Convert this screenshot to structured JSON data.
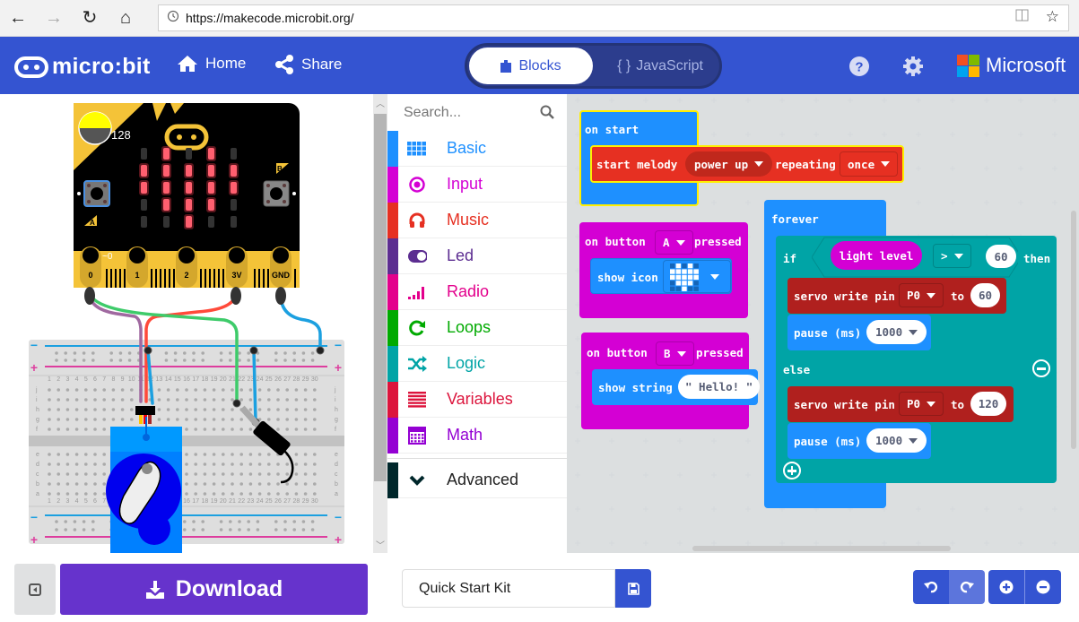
{
  "browser": {
    "url": "https://makecode.microbit.org/",
    "back_icon": "arrow-left",
    "forward_icon": "arrow-right",
    "refresh_icon": "refresh",
    "home_icon": "home",
    "back_glyph": "←",
    "forward_glyph": "→",
    "refresh_glyph": "↻",
    "home_glyph": "⌂",
    "star_glyph": "☆",
    "reader_glyph": "▯"
  },
  "header": {
    "logo_text": "micro:bit",
    "home_label": "Home",
    "share_label": "Share",
    "mode_blocks_label": "Blocks",
    "mode_js_label": "JavaScript",
    "mode_js_prefix": "{ }",
    "active_mode": "Blocks",
    "brand_label": "Microsoft",
    "colors": {
      "header_bg": "#3454d1",
      "toggle_bg": "#2c3d8d"
    }
  },
  "simulator": {
    "light_level_value": "128",
    "pin0_value": "~0",
    "pins": [
      "0",
      "1",
      "2",
      "3V",
      "GND"
    ],
    "button_a": "A",
    "button_b": "B",
    "led_matrix": [
      [
        0,
        1,
        0,
        1,
        0
      ],
      [
        1,
        1,
        1,
        1,
        1
      ],
      [
        1,
        1,
        1,
        1,
        1
      ],
      [
        0,
        1,
        1,
        1,
        0
      ],
      [
        0,
        0,
        1,
        0,
        0
      ]
    ],
    "breadboard_cols": [
      "1",
      "2",
      "3",
      "4",
      "5",
      "6",
      "7",
      "8",
      "9",
      "10",
      "11",
      "12",
      "13",
      "14",
      "15",
      "16",
      "17",
      "18",
      "19",
      "20",
      "21",
      "22",
      "23",
      "24",
      "25",
      "26",
      "27",
      "28",
      "29",
      "30"
    ],
    "breadboard_rows_top": [
      "j",
      "i",
      "h",
      "g",
      "f"
    ],
    "breadboard_rows_bottom": [
      "e",
      "d",
      "c",
      "b",
      "a"
    ]
  },
  "toolbox": {
    "search_placeholder": "Search...",
    "categories": [
      {
        "label": "Basic",
        "color": "#1e90ff",
        "icon": "grid-icon"
      },
      {
        "label": "Input",
        "color": "#d400d4",
        "icon": "target-icon"
      },
      {
        "label": "Music",
        "color": "#e63022",
        "icon": "headphones-icon"
      },
      {
        "label": "Led",
        "color": "#5c2d91",
        "icon": "toggle-icon"
      },
      {
        "label": "Radio",
        "color": "#e3008c",
        "icon": "signal-icon"
      },
      {
        "label": "Loops",
        "color": "#00aa00",
        "icon": "loop-icon"
      },
      {
        "label": "Logic",
        "color": "#00a4a6",
        "icon": "shuffle-icon"
      },
      {
        "label": "Variables",
        "color": "#dc143c",
        "icon": "list-icon"
      },
      {
        "label": "Math",
        "color": "#9400d3",
        "icon": "calculator-icon"
      }
    ],
    "advanced": {
      "label": "Advanced",
      "color": "#00272b",
      "icon": "chevron-down-icon"
    }
  },
  "workspace": {
    "on_start": {
      "label": "on start",
      "stmt_start_melody": "start melody",
      "melody": "power up",
      "repeating_label": "repeating",
      "repeat_option": "once"
    },
    "button_a": {
      "prefix": "on button",
      "button": "A",
      "suffix": "pressed",
      "stmt": "show icon",
      "icon_pattern": [
        [
          0,
          1,
          0,
          1,
          0
        ],
        [
          1,
          1,
          1,
          1,
          1
        ],
        [
          1,
          1,
          1,
          1,
          1
        ],
        [
          0,
          1,
          1,
          1,
          0
        ],
        [
          0,
          0,
          1,
          0,
          0
        ]
      ]
    },
    "button_b": {
      "prefix": "on button",
      "button": "B",
      "suffix": "pressed",
      "stmt": "show string",
      "string_value": "\" Hello! \""
    },
    "forever": {
      "label": "forever",
      "if_label": "if",
      "cond_sensor": "light level",
      "cond_op": ">",
      "cond_value": "60",
      "then_label": "then",
      "else_label": "else",
      "servo1": {
        "label": "servo write pin",
        "pin": "P0",
        "to": "to",
        "value": "60"
      },
      "pause1": {
        "label": "pause (ms)",
        "value": "1000"
      },
      "servo2": {
        "label": "servo write pin",
        "pin": "P0",
        "to": "to",
        "value": "120"
      },
      "pause2": {
        "label": "pause (ms)",
        "value": "1000"
      }
    }
  },
  "bottom": {
    "download_label": "Download",
    "project_name": "Quick Start Kit",
    "save_icon": "floppy-icon"
  }
}
